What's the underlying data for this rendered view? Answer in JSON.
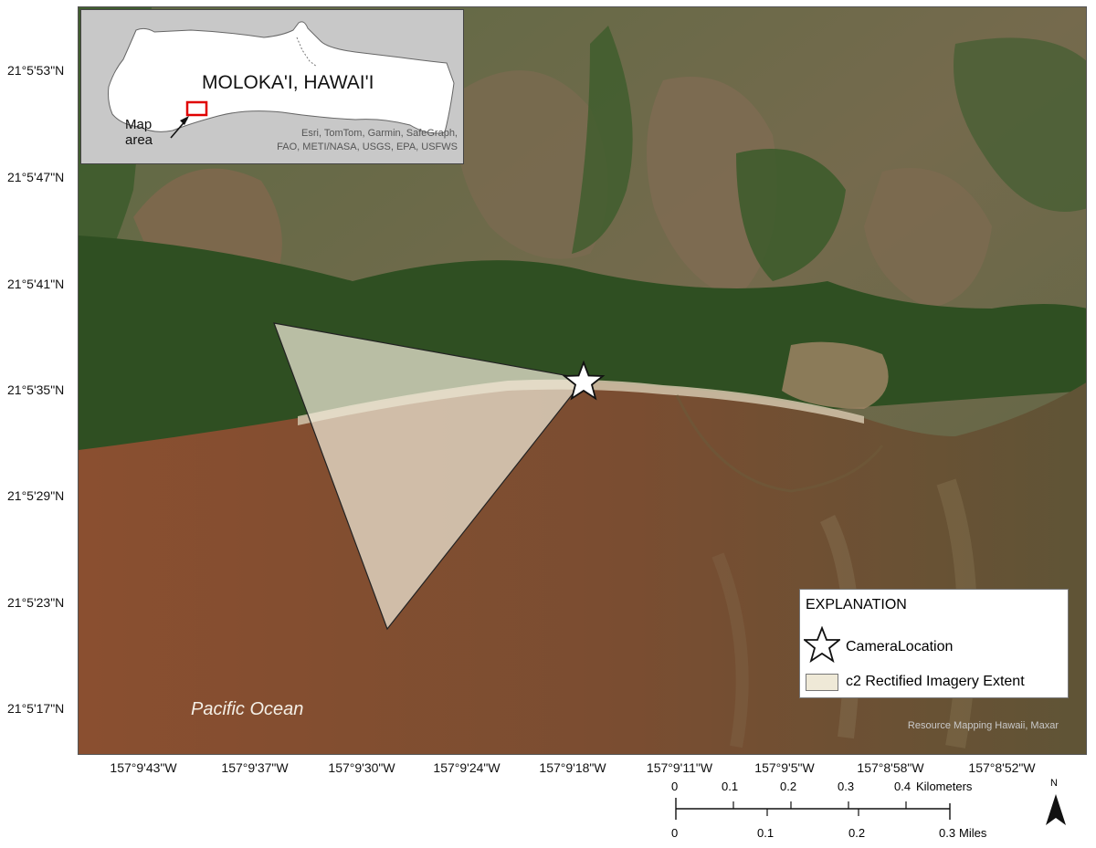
{
  "map": {
    "lat_labels": [
      "21°5'53\"N",
      "21°5'47\"N",
      "21°5'41\"N",
      "21°5'35\"N",
      "21°5'29\"N",
      "21°5'23\"N",
      "21°5'17\"N"
    ],
    "lon_labels": [
      "157°9'43\"W",
      "157°9'37\"W",
      "157°9'30\"W",
      "157°9'24\"W",
      "157°9'18\"W",
      "157°9'11\"W",
      "157°9'5\"W",
      "157°8'58\"W",
      "157°8'52\"W"
    ],
    "ocean_label": "Pacific Ocean",
    "basemap_attribution": "Resource Mapping Hawaii, Maxar",
    "colors": {
      "ocean": "#8a5132",
      "vegetation": "#2f4f22",
      "hills": "#6e6548",
      "beach": "#cdbfa5",
      "extent_fill": "#efe9d7"
    }
  },
  "inset": {
    "title": "MOLOKA'I, HAWAI'I",
    "map_area_label": "Map area",
    "attribution_line1": "Esri, TomTom, Garmin, SafeGraph,",
    "attribution_line2": "FAO, METI/NASA, USGS, EPA, USFWS",
    "highlight_color": "#e00000"
  },
  "legend": {
    "title": "EXPLANATION",
    "camera_label": "CameraLocation",
    "extent_label": "c2 Rectified Imagery Extent",
    "camera_icon": "star-icon"
  },
  "scale": {
    "km_ticks": [
      "0",
      "0.1",
      "0.2",
      "0.3",
      "0.4"
    ],
    "km_unit": "Kilometers",
    "mile_ticks": [
      "0",
      "0.1",
      "0.2",
      "0.3"
    ],
    "mile_unit": "Miles"
  },
  "north": {
    "letter": "N",
    "icon": "north-arrow-icon"
  }
}
